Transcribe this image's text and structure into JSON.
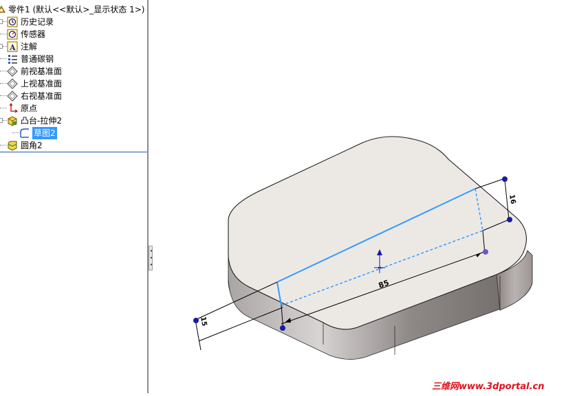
{
  "tree": {
    "root_label": "零件1  (默认<<默认>_显示状态 1>)",
    "items": [
      {
        "label": "历史记录"
      },
      {
        "label": "传感器"
      },
      {
        "label": "注解"
      },
      {
        "label": "普通碳钢"
      },
      {
        "label": "前视基准面"
      },
      {
        "label": "上视基准面"
      },
      {
        "label": "右视基准面"
      },
      {
        "label": "原点"
      },
      {
        "label": "凸台-拉伸2"
      },
      {
        "label": "草图2"
      },
      {
        "label": "圆角2"
      }
    ]
  },
  "viewport": {
    "dimension_length": "85",
    "dimension_right": "16",
    "dimension_left": "15"
  },
  "watermark": "三维网www.3dportal.cn",
  "colors": {
    "selection": "#3399ff",
    "sketch_line": "#3399ff",
    "dimension_point": "#1a1aa0",
    "top_face": "#ece9e5",
    "watermark": "#e0101a"
  }
}
